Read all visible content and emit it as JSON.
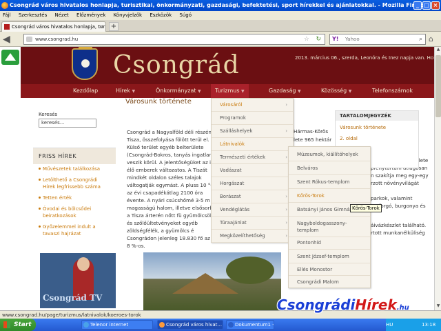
{
  "window": {
    "title": "Csongrád város hivatalos honlapja, turisztikai, önkormányzati, gazdasági, befektetési, sport hírekkel és ajánlatokkal. - Mozilla Firefox"
  },
  "menubar": [
    "Fájl",
    "Szerkesztés",
    "Nézet",
    "Előzmények",
    "Könyvjelzők",
    "Eszközök",
    "Súgó"
  ],
  "tab": {
    "label": "Csongrád város hivatalos honlapja, turisztik...",
    "new_tab": "+"
  },
  "nav": {
    "url": "www.csongrad.hu",
    "search_placeholder": "Yahoo",
    "search_engine": "Y!"
  },
  "site": {
    "title": "Csongrád",
    "dateline": "2013. március 06., szerda, Leonóra és Inez napja van. Holr",
    "nav": [
      {
        "label": "Kezdőlap",
        "caret": ""
      },
      {
        "label": "Hírek",
        "caret": "▼"
      },
      {
        "label": "Önkormányzat",
        "caret": "▼"
      },
      {
        "label": "Turizmus",
        "caret": "▼"
      },
      {
        "label": "Gazdaság",
        "caret": "▼"
      },
      {
        "label": "Közösség",
        "caret": "▼"
      },
      {
        "label": "Telefonszámok",
        "caret": ""
      }
    ],
    "brand_color": "#6b0f12",
    "accent_color": "#c97a0b"
  },
  "sidebar": {
    "search_label": "Keresés",
    "search_value": "keresés...",
    "friss_title": "FRISS HÍREK",
    "news": [
      "Művészetek találkozása",
      "Letölthető a Csongrádi Hírek legfrissebb száma",
      "Tetten érték",
      "Óvodai és bölcsődei beiratkozások",
      "Győzelemmel indult a tavaszi hajrázat"
    ],
    "tv_label": "Csongrád TV"
  },
  "article": {
    "title": "Városunk története",
    "body": "Csongrád a Nagyalföld déli részén, a Tisza, összefolyása fölött terül el. Külső terület egyéb belterülete (Csongrád-Bokros, tanyás ingatlanok veszik körül. A jelentőségüket az itt élő emberek változatos. A Tiszát mindkét oldalon széles talajok váltogatják egymást. A pluss 10 °C, az évi csapadékátlag 2100 óra évente. A nyári csúcshőmé 3-5 m magasságú halom, illetve elsősorban a Tisza árterén nőtt fü gyümölcsöket és szőlőültetvényeket egyéb zöldségfélék, a gyümölcs é Csongrádon jelenleg 18.830 fő az kb. 8 %-os.",
    "right_fragments": [
      "Hármas-Körös",
      "lete 965 hektár",
      "évi középhőmérséklete",
      "pfénytartam átlagosan",
      "n szakítja meg egy-egy",
      "rzott növényvilágát",
      "parkok, valamint",
      "eraforgó, burgonya és",
      "áivázkészlet található.",
      "rtott munkanélküliség"
    ]
  },
  "toc": {
    "title": "TARTALOMJEGYZÉK",
    "links": [
      "Városunk története",
      "2. oldal"
    ]
  },
  "dropdown": {
    "items": [
      {
        "label": "Városáról",
        "arrow": "›",
        "highlight": true
      },
      {
        "label": "Programok",
        "arrow": "",
        "highlight": false
      },
      {
        "label": "Szálláshelyek",
        "arrow": "›",
        "highlight": false
      },
      {
        "label": "Látnivalók",
        "arrow": "",
        "highlight": true
      },
      {
        "label": "Természeti értékek",
        "arrow": "›",
        "highlight": false
      },
      {
        "label": "Vadászat",
        "arrow": "",
        "highlight": false
      },
      {
        "label": "Horgászat",
        "arrow": "",
        "highlight": false
      },
      {
        "label": "Borászat",
        "arrow": "›",
        "highlight": false
      },
      {
        "label": "Vendéglátás",
        "arrow": "›",
        "highlight": false
      },
      {
        "label": "Túraajánlat",
        "arrow": "›",
        "highlight": false
      },
      {
        "label": "Megközelíthetőség",
        "arrow": "›",
        "highlight": false
      }
    ],
    "sub_items": [
      {
        "label": "Múzeumok, kiállítóhelyek",
        "highlight": false
      },
      {
        "label": "Belváros",
        "highlight": false
      },
      {
        "label": "Szent Rókus-templom",
        "highlight": false
      },
      {
        "label": "Kőrös-Torok",
        "highlight": true
      },
      {
        "label": "Batsányi János Gimnázium",
        "highlight": false
      },
      {
        "label": "Nagyboldogasszony-",
        "highlight": false
      },
      {
        "label": "templom",
        "highlight": false
      },
      {
        "label": "Pontonhíd",
        "highlight": false
      },
      {
        "label": "Szent József-templom",
        "highlight": false
      },
      {
        "label": "Ellés Monostor",
        "highlight": false
      },
      {
        "label": "Csongrádi Malom",
        "highlight": false
      }
    ],
    "tooltip": "Kőrös-Torok"
  },
  "status": {
    "text": "www.csongrad.hu/page/turizmus/latnivalok/koeroes-torok"
  },
  "watermark": {
    "part1": "Csongrádi",
    "part2": "Hírek",
    "suffix": ".hu"
  },
  "taskbar": {
    "start": "Start",
    "buttons": [
      "Telenor internet",
      "Csongrád város hivat...",
      "Dokumentum1 - Micro..."
    ],
    "tray": "HU",
    "clock": "13:18"
  }
}
